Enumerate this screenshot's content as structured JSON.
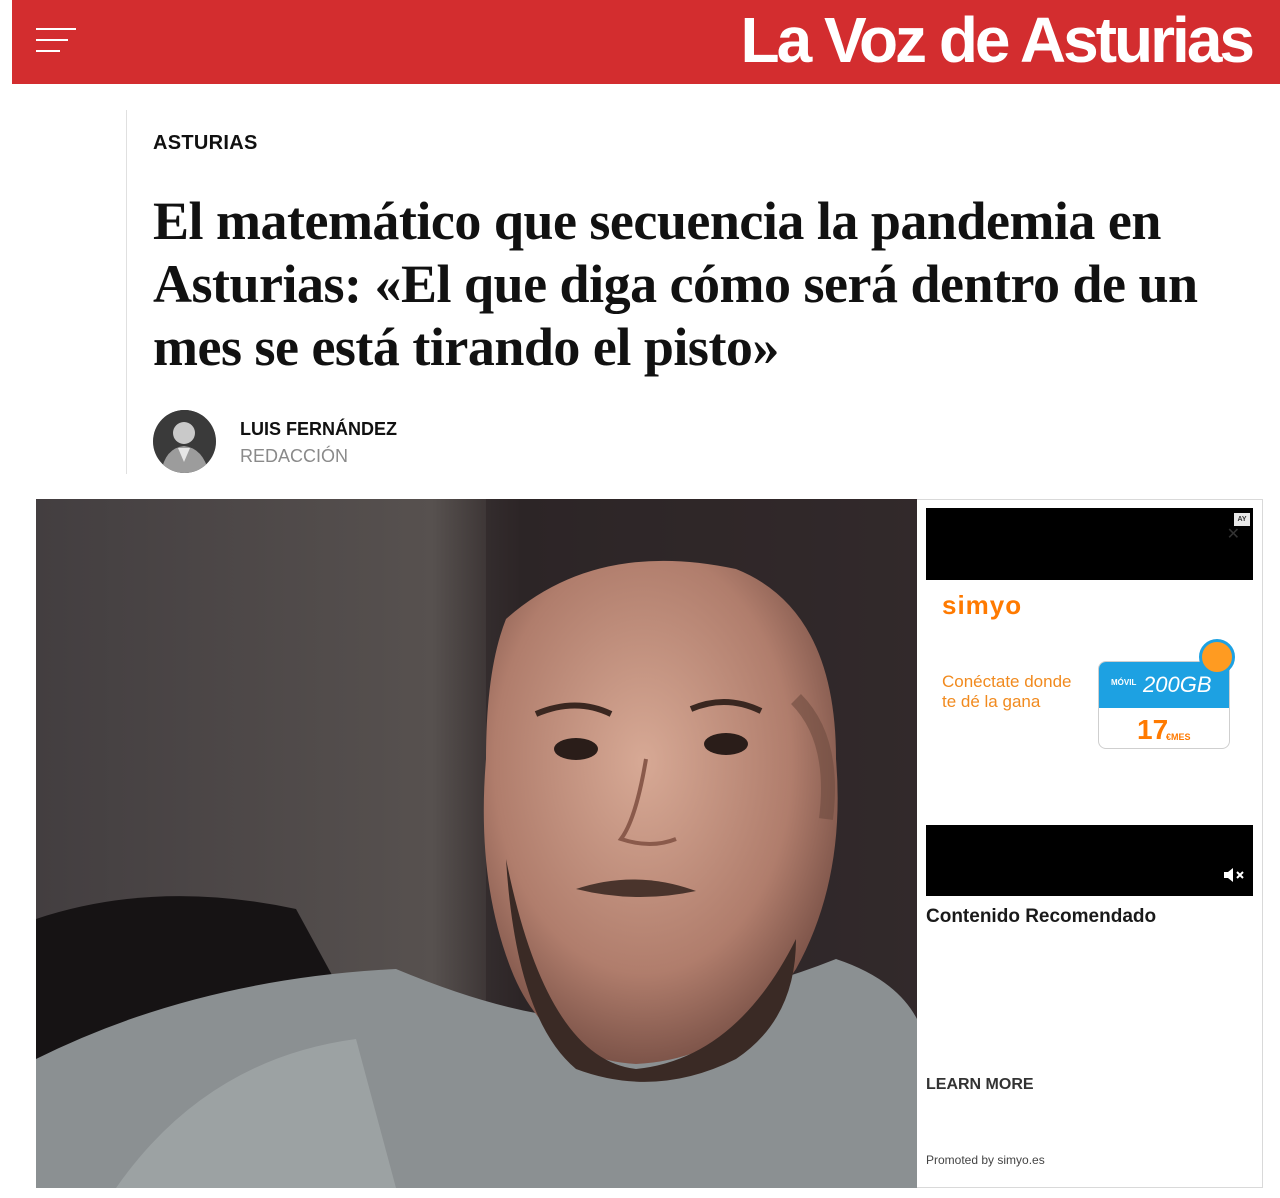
{
  "header": {
    "logo_text": "La Voz de Asturias",
    "brand_color": "#d32d2f"
  },
  "article": {
    "section": "ASTURIAS",
    "headline": "El matemático que secuencia la pandemia en Asturias: «El que diga cómo será dentro de un mes se está tirando el pisto»",
    "author": {
      "name": "LUIS FERNÁNDEZ",
      "role": "REDACCIÓN"
    }
  },
  "ad": {
    "badge": "AY",
    "brand": "simyo",
    "tagline": "Conéctate donde te dé la gana",
    "plan_label": "MÓVIL",
    "plan_data": "200GB",
    "plan_price": "17",
    "plan_unit": "€MES",
    "recommended_title": "Contenido Recomendado",
    "cta": "LEARN MORE",
    "promoted_by": "Promoted by simyo.es",
    "accent_orange": "#ff7a00",
    "accent_blue": "#1da1e2"
  }
}
